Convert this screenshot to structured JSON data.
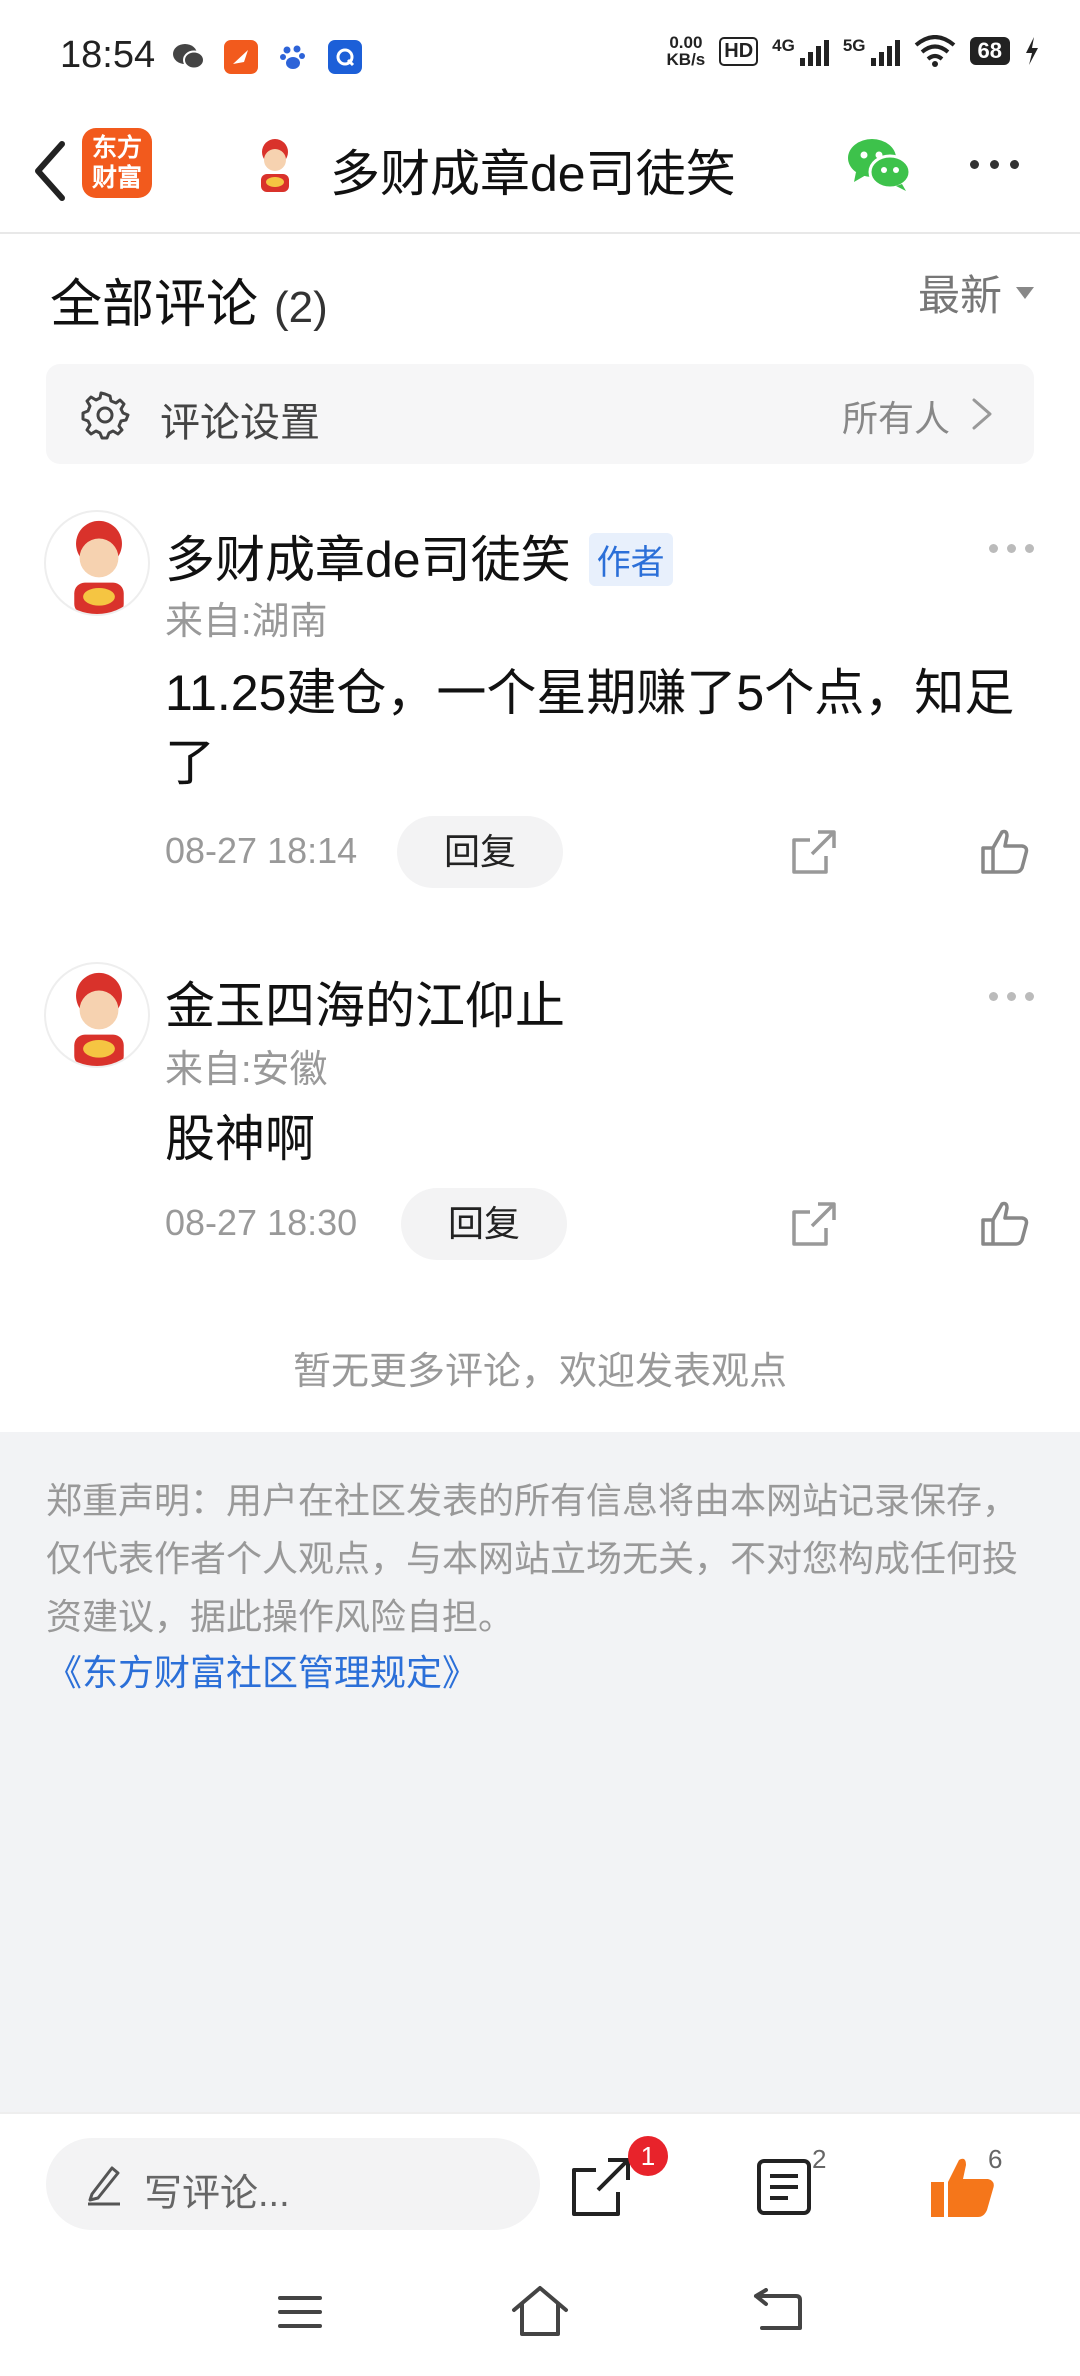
{
  "status_bar": {
    "time": "18:54",
    "net_speed_value": "0.00",
    "net_speed_unit": "KB/s",
    "hd_label": "HD",
    "network_1": "4G",
    "network_2": "5G",
    "battery": "68",
    "app_icons": [
      "wechat-icon",
      "app-icon",
      "baidu-icon",
      "app-icon"
    ]
  },
  "header": {
    "logo_line1": "东方",
    "logo_line2": "财富",
    "title": "多财成章de司徒笑"
  },
  "comments_section": {
    "title": "全部评论",
    "count": "(2)",
    "sort_label": "最新",
    "settings_label": "评论设置",
    "settings_value": "所有人"
  },
  "comments": [
    {
      "author": "多财成章de司徒笑",
      "badge": "作者",
      "location": "来自:湖南",
      "text": "11.25建仓，一个星期赚了5个点，知足了",
      "time": "08-27 18:14",
      "reply_label": "回复"
    },
    {
      "author": "金玉四海的江仰止",
      "location": "来自:安徽",
      "text": "股神啊",
      "time": "08-27 18:30",
      "reply_label": "回复"
    }
  ],
  "no_more_text": "暂无更多评论，欢迎发表观点",
  "disclaimer": {
    "text": "郑重声明：用户在社区发表的所有信息将由本网站记录保存，仅代表作者个人观点，与本网站立场无关，不对您构成任何投资建议，据此操作风险自担。",
    "link": "《东方财富社区管理规定》"
  },
  "bottom_bar": {
    "write_placeholder": "写评论...",
    "share_badge": "1",
    "list_count": "2",
    "like_count": "6",
    "like_color": "#f5761a"
  },
  "colors": {
    "brand": "#f25a1d",
    "link": "#2b6fd8",
    "badge_red": "#e8232b",
    "wechat_green": "#3dc24b"
  }
}
